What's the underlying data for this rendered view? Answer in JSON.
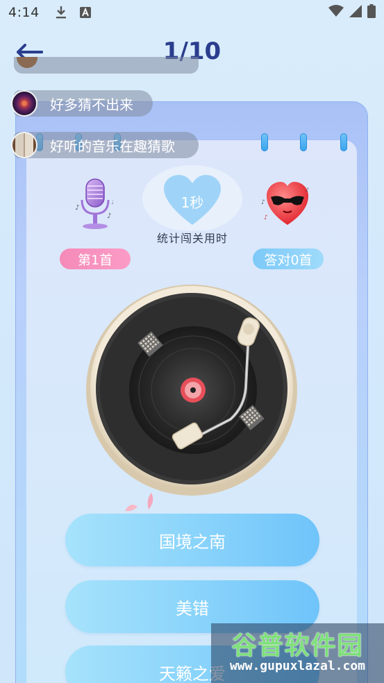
{
  "status_bar": {
    "time": "4:14",
    "icons": [
      "download-icon",
      "a-badge-icon",
      "wifi-icon",
      "signal-icon",
      "battery-icon"
    ]
  },
  "header": {
    "title": "1/10",
    "back_icon": "back-arrow-icon"
  },
  "danmaku": [
    {
      "text": "好多猜不出来",
      "avatar": "fireworks-avatar"
    },
    {
      "text": "好听的音乐在趣猜歌",
      "avatar": "book-avatar"
    }
  ],
  "stats": {
    "timer_value": "1秒",
    "timer_caption": "统计闯关用时",
    "current_song": "第1首",
    "correct_count": "答对0首"
  },
  "answers": [
    {
      "label": "国境之南"
    },
    {
      "label": "美错"
    },
    {
      "label": "天籁之爱"
    }
  ],
  "watermark": {
    "title": "谷普软件园",
    "url": "www.gupuxlazal.com"
  },
  "colors": {
    "title": "#2a3d8e",
    "pill_pink": "#f58ab8",
    "pill_blue": "#7cc9f8",
    "answer_button": "#8bd4fb"
  }
}
